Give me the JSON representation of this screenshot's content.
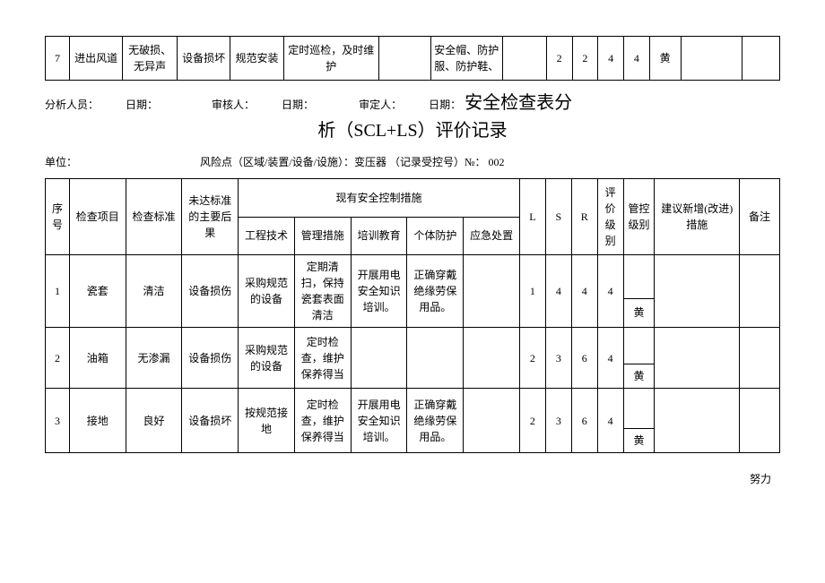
{
  "top_row": {
    "seq": "7",
    "item": "进出风道",
    "standard": "无破损、无异声",
    "consequence": "设备损坏",
    "eng": "规范安装",
    "mgmt": "定时巡检，及时维护",
    "train": "",
    "ppe": "安全帽、防护服、防护鞋、",
    "emerg": "",
    "L": "2",
    "S": "2",
    "R": "4",
    "level": "4",
    "color": "黄"
  },
  "sign": {
    "analyst": "分析人员：",
    "date1": "日期：",
    "reviewer": "审核人：",
    "date2": "日期：",
    "approver": "审定人：",
    "date3": "日期："
  },
  "title_part1": "安全检查表分",
  "title_line2": "析（SCL+LS）评价记录",
  "unit_label": "单位：",
  "risk_point_label": "风险点（区域/装置/设备/设施）：变压器  （记录受控号）№： 002",
  "headers": {
    "seq": "序号",
    "item": "检查项目",
    "standard": "检查标准",
    "consequence": "未达标准的主要后果",
    "measures": "现有安全控制措施",
    "eng": "工程技术",
    "mgmt": "管理措施",
    "train": "培训教育",
    "ppe": "个体防护",
    "emerg": "应急处置",
    "L": "L",
    "S": "S",
    "R": "R",
    "level": "评价级别",
    "ctrl_level": "管控级别",
    "suggest": "建议新增(改进)措施",
    "remark": "备注"
  },
  "rows": [
    {
      "seq": "1",
      "item": "瓷套",
      "standard": "清洁",
      "consequence": "设备损伤",
      "eng": "采购规范的设备",
      "mgmt": "定期清扫，保持瓷套表面清洁",
      "train": "开展用电安全知识培训。",
      "ppe": "正确穿戴绝缘劳保用品。",
      "emerg": "",
      "L": "1",
      "S": "4",
      "R": "4",
      "level": "4",
      "ctrl": "黄",
      "suggest": "",
      "remark": ""
    },
    {
      "seq": "2",
      "item": "油箱",
      "standard": "无渗漏",
      "consequence": "设备损伤",
      "eng": "采购规范的设备",
      "mgmt": "定时检查，维护保养得当",
      "train": "",
      "ppe": "",
      "emerg": "",
      "L": "2",
      "S": "3",
      "R": "6",
      "level": "4",
      "ctrl": "黄",
      "suggest": "",
      "remark": ""
    },
    {
      "seq": "3",
      "item": "接地",
      "standard": "良好",
      "consequence": "设备损坏",
      "eng": "按规范接地",
      "mgmt": "定时检查，维护保养得当",
      "train": "开展用电安全知识培训。",
      "ppe": "正确穿戴绝缘劳保用品。",
      "emerg": "",
      "L": "2",
      "S": "3",
      "R": "6",
      "level": "4",
      "ctrl": "黄",
      "suggest": "",
      "remark": ""
    }
  ],
  "footer": "努力"
}
